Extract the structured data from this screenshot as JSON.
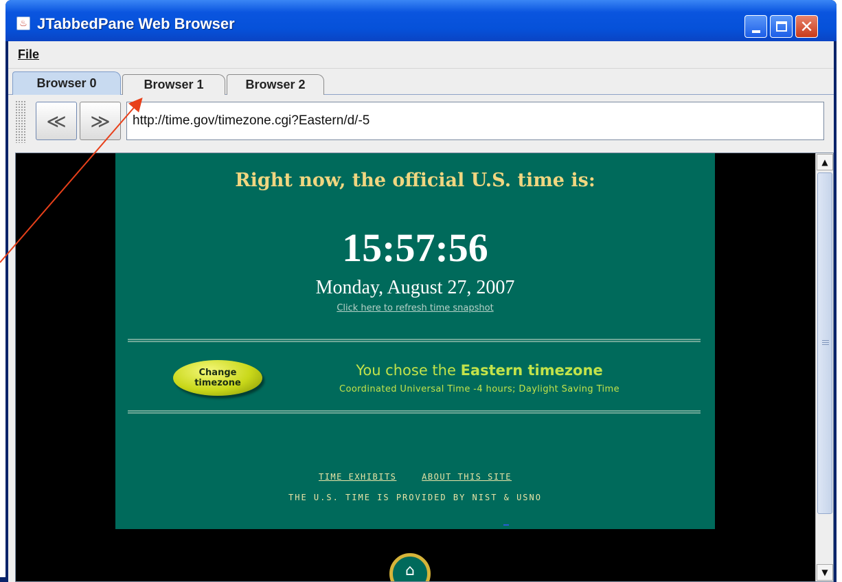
{
  "window": {
    "title": "JTabbedPane Web Browser",
    "close_glyph": "✕"
  },
  "menu": {
    "file_label": "File"
  },
  "tabs": [
    {
      "label": "Browser 0"
    },
    {
      "label": "Browser 1"
    },
    {
      "label": "Browser 2"
    }
  ],
  "toolbar": {
    "back_glyph": "≪",
    "forward_glyph": "≫",
    "address_value": "http://time.gov/timezone.cgi?Eastern/d/-5"
  },
  "webpage": {
    "headline": "Right now, the official U.S. time is:",
    "time": "15:57:56",
    "date": "Monday, August 27, 2007",
    "refresh_link": "Click here to refresh time snapshot",
    "change_button_line1": "Change",
    "change_button_line2": "timezone",
    "tz_prefix": "You chose the ",
    "tz_name": "Eastern timezone",
    "tz_detail": "Coordinated Universal Time -4 hours; Daylight Saving Time",
    "footer_link_1": "TIME EXHIBITS",
    "footer_link_2": "ABOUT THIS SITE",
    "provider_text": "THE U.S. TIME IS PROVIDED BY NIST & USNO",
    "home_glyph": "⌂"
  },
  "scrollbar": {
    "up_glyph": "▲",
    "down_glyph": "▼"
  },
  "colors": {
    "page_background": "#006a5b",
    "headline": "#f0d680",
    "timezone_text": "#c3e34a",
    "annotation_arrow": "#e8401a"
  }
}
